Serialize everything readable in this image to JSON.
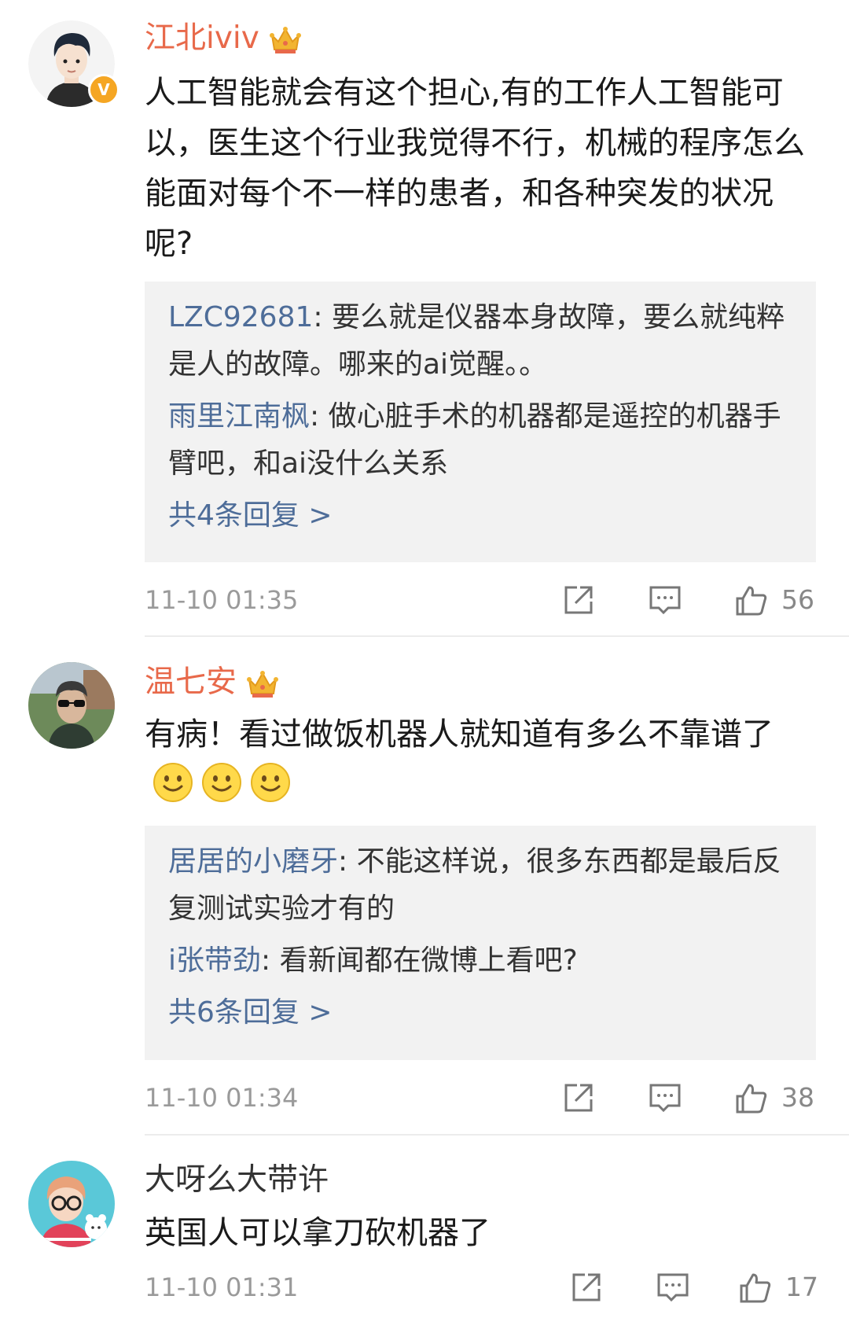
{
  "comments": [
    {
      "author": "江北iviv",
      "text": "人工智能就会有这个担心,有的工作人工智能可以，医生这个行业我觉得不行，机械的程序怎么能面对每个不一样的患者，和各种突发的状况呢?",
      "replies": [
        {
          "user": "LZC92681",
          "sep": ": ",
          "text": "要么就是仪器本身故障，要么就纯粹是人的故障。哪来的ai觉醒。。"
        },
        {
          "user": "雨里江南枫",
          "sep": ": ",
          "text": "做心脏手术的机器都是遥控的机器手臂吧，和ai没什么关系"
        }
      ],
      "more": "共4条回复 >",
      "time": "11-10 01:35",
      "likes": "56",
      "verified_mark": "V"
    },
    {
      "author": "温七安",
      "text": "有病！看过做饭机器人就知道有多么不靠谱了",
      "emoji": "smile-emoji",
      "replies": [
        {
          "user": "居居的小磨牙",
          "sep": ": ",
          "text": "不能这样说，很多东西都是最后反复测试实验才有的"
        },
        {
          "user": "i张带劲",
          "sep": ": ",
          "text": "看新闻都在微博上看吧?"
        }
      ],
      "more": "共6条回复 >",
      "time": "11-10 01:34",
      "likes": "38"
    },
    {
      "author": "大呀么大带许",
      "text": "英国人可以拿刀砍机器了",
      "time": "11-10 01:31",
      "likes": "17"
    }
  ],
  "icons": {
    "share": "share-icon",
    "comment": "comment-icon",
    "like": "thumbs-up-icon",
    "crown": "vip-crown-icon"
  },
  "colors": {
    "vip_name": "#e8694a",
    "reply_user": "#4e6d99",
    "reply_bg": "#f2f2f2",
    "meta": "#9a9a9a",
    "crown": "#f2b431"
  }
}
